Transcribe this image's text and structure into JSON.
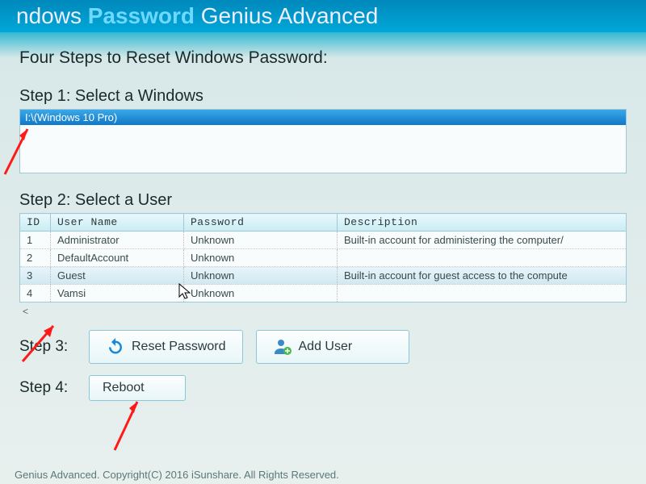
{
  "header": {
    "seg1": "ndows",
    "seg2": "Password",
    "seg3": "Genius Advanced"
  },
  "headings": {
    "main": "Four Steps to Reset Windows Password:",
    "step1": "Step 1: Select a Windows",
    "step2": "Step 2: Select a User",
    "step3": "Step 3:",
    "step4": "Step 4:"
  },
  "windows_list": {
    "items": [
      "I:\\(Windows 10 Pro)"
    ]
  },
  "user_table": {
    "columns": {
      "id": "ID",
      "user": "User Name",
      "pass": "Password",
      "desc": "Description"
    },
    "rows": [
      {
        "id": "1",
        "user": "Administrator",
        "pass": "Unknown",
        "desc": "Built-in account for administering the computer/"
      },
      {
        "id": "2",
        "user": "DefaultAccount",
        "pass": "Unknown",
        "desc": ""
      },
      {
        "id": "3",
        "user": "Guest",
        "pass": "Unknown",
        "desc": "Built-in account for guest access to the compute"
      },
      {
        "id": "4",
        "user": "Vamsi",
        "pass": "Unknown",
        "desc": ""
      }
    ],
    "scroll_hint": "<"
  },
  "buttons": {
    "reset": "Reset Password",
    "add_user": "Add User",
    "reboot": "Reboot"
  },
  "footer": "Genius Advanced. Copyright(C) 2016 iSunshare. All Rights Reserved.",
  "icons": {
    "refresh": "refresh-icon",
    "add_user": "add-user-icon"
  },
  "colors": {
    "header_bg": "#0099cc",
    "selection": "#1a88d8",
    "button_border": "#88c8d8",
    "annotation_arrow": "#ff1a1a"
  }
}
